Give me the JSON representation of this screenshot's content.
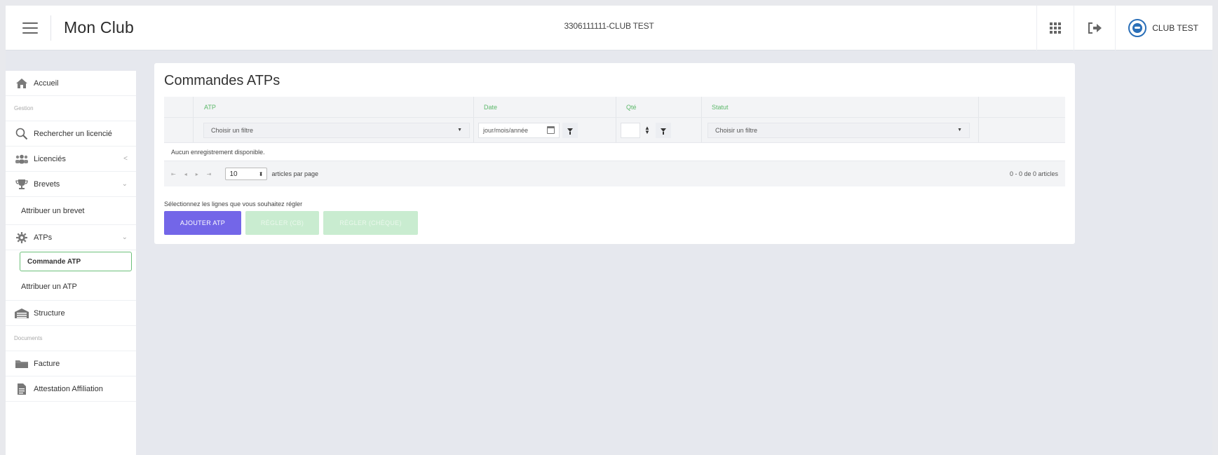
{
  "header": {
    "app_title": "Mon Club",
    "club_id": "3306111111-CLUB TEST",
    "user_name": "CLUB TEST"
  },
  "sidebar": {
    "items": [
      {
        "label": "Accueil",
        "icon": "home-icon"
      },
      {
        "label": "Gestion",
        "type": "section"
      },
      {
        "label": "Rechercher un licencié",
        "icon": "search-icon"
      },
      {
        "label": "Licenciés",
        "icon": "people-icon",
        "chevron": "<"
      },
      {
        "label": "Brevets",
        "icon": "trophy-icon",
        "chevron": "⌄"
      },
      {
        "label": "Attribuer un brevet",
        "type": "sub"
      },
      {
        "label": "ATPs",
        "icon": "gear-icon",
        "chevron": "⌄"
      },
      {
        "label": "Commande ATP",
        "type": "sub",
        "active": true
      },
      {
        "label": "Attribuer un ATP",
        "type": "sub"
      },
      {
        "label": "Structure",
        "icon": "building-icon"
      },
      {
        "label": "Documents",
        "type": "section"
      },
      {
        "label": "Facture",
        "icon": "folder-icon"
      },
      {
        "label": "Attestation Affiliation",
        "icon": "document-icon"
      }
    ]
  },
  "main": {
    "title": "Commandes ATPs",
    "table": {
      "columns": [
        "ATP",
        "Date",
        "Qté",
        "Statut"
      ],
      "filters": {
        "atp_placeholder": "Choisir un filtre",
        "date_placeholder": "jour/mois/année",
        "statut_placeholder": "Choisir un filtre"
      },
      "empty_text": "Aucun enregistrement disponible.",
      "pager": {
        "page_size": "10",
        "page_size_label": "articles par page",
        "info": "0 - 0 de 0 articles"
      }
    },
    "select_hint": "Sélectionnez les lignes que vous souhaitez régler",
    "buttons": {
      "add": "AJOUTER ATP",
      "pay_cb": "RÉGLER (CB)",
      "pay_cheque": "RÉGLER (CHÈQUE)"
    }
  },
  "colors": {
    "accent": "#7366e8",
    "green": "#5cb86a",
    "disabled_green": "#c9ecd0"
  }
}
